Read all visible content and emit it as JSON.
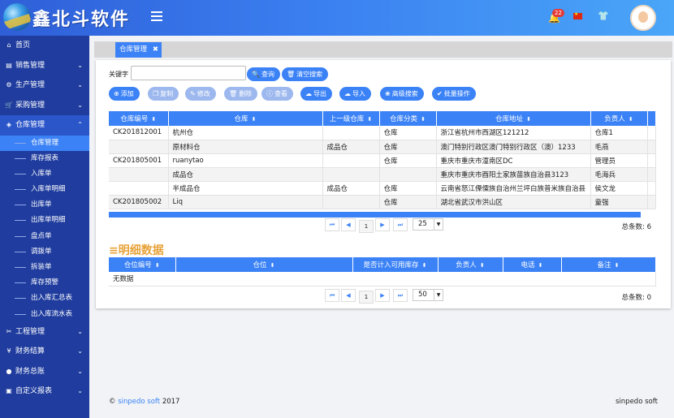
{
  "app": {
    "brand": "鑫北斗软件",
    "notification_count": "22"
  },
  "sidebar": {
    "top": [
      {
        "label": "首页",
        "icon": "home-icon",
        "glyph": "⌂",
        "chev": ""
      },
      {
        "label": "销售管理",
        "icon": "sales-icon",
        "glyph": "▤",
        "chev": "⌄"
      },
      {
        "label": "生产管理",
        "icon": "production-icon",
        "glyph": "⚙",
        "chev": "⌄"
      },
      {
        "label": "采购管理",
        "icon": "cart-icon",
        "glyph": "🛒",
        "chev": "⌄"
      },
      {
        "label": "仓库管理",
        "icon": "cube-icon",
        "glyph": "◈",
        "chev": "⌃"
      }
    ],
    "sub": [
      "仓库管理",
      "库存报表",
      "入库单",
      "入库单明细",
      "出库单",
      "出库单明细",
      "盘点单",
      "调拨单",
      "拆装单",
      "库存预警",
      "出入库汇总表",
      "出入库流水表"
    ],
    "bottom": [
      {
        "label": "工程管理",
        "icon": "tools-icon",
        "glyph": "✂",
        "chev": "⌄"
      },
      {
        "label": "财务结算",
        "icon": "yen-icon",
        "glyph": "¥",
        "chev": "⌄"
      },
      {
        "label": "财务总账",
        "icon": "ledger-icon",
        "glyph": "●",
        "chev": "⌄"
      },
      {
        "label": "自定义报表",
        "icon": "report-icon",
        "glyph": "▣",
        "chev": "⌄"
      }
    ]
  },
  "tab": {
    "label": "仓库管理",
    "close": "✖"
  },
  "search": {
    "label": "关键字",
    "value": "",
    "placeholder": "",
    "query_btn": "查询",
    "clear_btn": "清空搜索"
  },
  "toolbar": [
    {
      "label": "添加",
      "icon": "plus-icon",
      "glyph": "⊕",
      "enabled": true
    },
    {
      "label": "复制",
      "icon": "copy-icon",
      "glyph": "❐",
      "enabled": false
    },
    {
      "label": "修改",
      "icon": "pencil-icon",
      "glyph": "✎",
      "enabled": false
    },
    {
      "label": "删除",
      "icon": "trash-icon",
      "glyph": "🗑",
      "enabled": false
    },
    {
      "label": "查看",
      "icon": "info-icon",
      "glyph": "ⓘ",
      "enabled": false
    },
    {
      "label": "导出",
      "icon": "cloud-upload-icon",
      "glyph": "☁",
      "enabled": true
    },
    {
      "label": "导入",
      "icon": "cloud-download-icon",
      "glyph": "☁",
      "enabled": true
    },
    {
      "label": "高级搜索",
      "icon": "paw-icon",
      "glyph": "❀",
      "enabled": true
    },
    {
      "label": "批量操作",
      "icon": "check-circle-icon",
      "glyph": "✔",
      "enabled": true
    }
  ],
  "table": {
    "columns": [
      "仓库编号",
      "仓库",
      "上一级仓库",
      "仓库分类",
      "仓库地址",
      "负责人",
      ""
    ],
    "rows": [
      [
        "CK201812001",
        "杭州仓",
        "",
        "仓库",
        "浙江省杭州市西湖区121212",
        "仓库1",
        ""
      ],
      [
        "",
        "原材料仓",
        "成品仓",
        "仓库",
        "澳门特别行政区澳门特别行政区（澳）1233",
        "毛燕",
        ""
      ],
      [
        "CK201805001",
        "ruanytao",
        "",
        "仓库",
        "重庆市重庆市潼南区DC",
        "管理员",
        ""
      ],
      [
        "",
        "成品仓",
        "",
        "",
        "重庆市重庆市酉阳土家族苗族自治县3123",
        "毛海兵",
        ""
      ],
      [
        "",
        "半成品仓",
        "成品仓",
        "仓库",
        "云南省怒江傈僳族自治州兰坪白族普米族自治县",
        "侯文龙",
        ""
      ],
      [
        "CK201805002",
        "Liq",
        "",
        "仓库",
        "湖北省武汉市洪山区",
        "童强",
        ""
      ]
    ]
  },
  "pager1": {
    "first": "⏮",
    "prev": "◀",
    "page": "1",
    "next": "▶",
    "last": "⏭",
    "size": "25",
    "total": "总条数: 6"
  },
  "detail": {
    "title": "≡明细数据",
    "columns": [
      "仓位编号",
      "仓位",
      "是否计入可用库存",
      "负责人",
      "电话",
      "备注"
    ],
    "empty": "无数据"
  },
  "pager2": {
    "first": "⏮",
    "prev": "◀",
    "page": "1",
    "next": "▶",
    "last": "⏭",
    "size": "50",
    "total": "总条数: 0"
  },
  "footer": {
    "copyright": "©",
    "company_link": "sinpedo soft",
    "year": "2017",
    "right": "sinpedo soft"
  },
  "colors": {
    "primary": "#3b82f6",
    "sidebar": "#1f3c9e",
    "accent": "#e8a33a"
  }
}
